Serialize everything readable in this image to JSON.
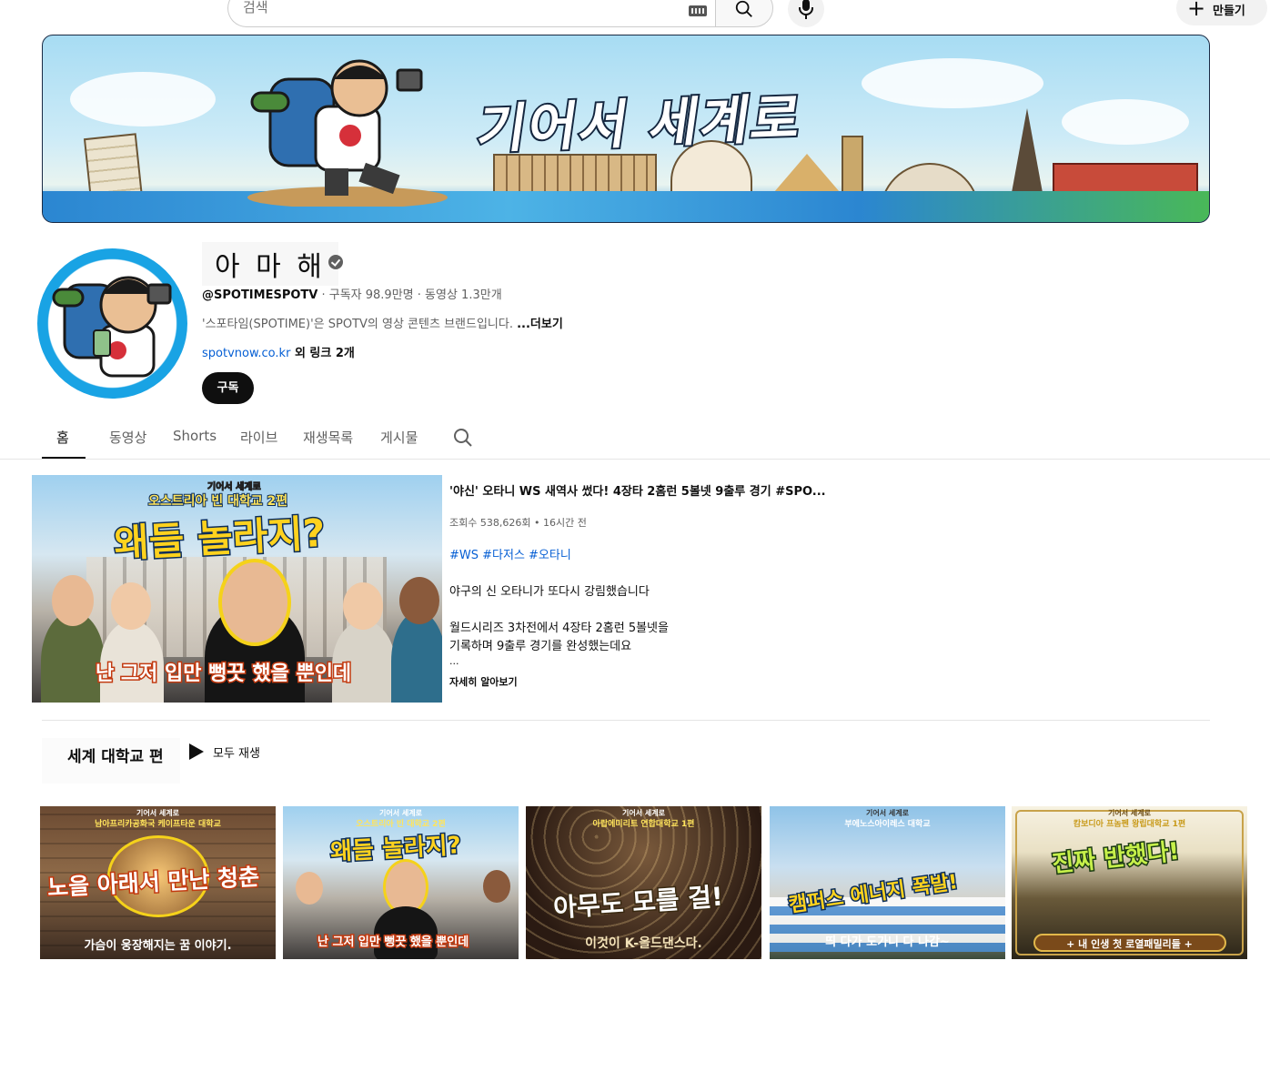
{
  "topbar": {
    "search_placeholder": "검색",
    "create_label": "만들기"
  },
  "banner": {
    "title": "기어서 세계로"
  },
  "channel": {
    "name": "아 마 해",
    "handle": "@SPOTIMESPOTV",
    "subscribers": "구독자 98.9만명",
    "videos": "동영상 1.3만개",
    "description": "'스포타임(SPOTIME)'은 SPOTV의 영상 콘텐츠 브랜드입니다.",
    "more": "...더보기",
    "link_url": "spotvnow.co.kr",
    "link_more": " 외 링크 2개",
    "subscribe_label": "구독"
  },
  "tabs": [
    {
      "label": "홈"
    },
    {
      "label": "동영상"
    },
    {
      "label": "Shorts"
    },
    {
      "label": "라이브"
    },
    {
      "label": "재생목록"
    },
    {
      "label": "게시물"
    }
  ],
  "featured": {
    "thumb_top": "기어서 세계로",
    "thumb_sub": "오스트리아 빈 대학교 2편",
    "thumb_main": "왜들 놀라지?",
    "thumb_bottom": "난 그저 입만 뻥끗 했을 뿐인데",
    "title": "'야신' 오타니 WS 새역사 썼다! 4장타 2홈런 5볼넷 9출루 경기 #SPO...",
    "views": "조회수 538,626회",
    "age": "16시간 전",
    "tags": "#WS #다저스 #오타니",
    "line1": "야구의 신 오타니가 또다시 강림했습니다",
    "line2": "월드시리즈 3차전에서 4장타 2홈런 5볼넷을",
    "line3": "기록하며 9출루 경기를 완성했는데요",
    "line4": "...",
    "more": "자세히 알아보기"
  },
  "shelf": {
    "title": "세계 대학교 편",
    "play_all": "모두 재생",
    "cards": [
      {
        "top": "기어서 세계로",
        "sub": "남아프리카공화국 케이프타운 대학교",
        "main": "노을 아래서 만난 청춘",
        "bottom": "가슴이 웅장해지는 꿈 이야기."
      },
      {
        "top": "기어서 세계로",
        "sub": "오스트리아 빈 대학교 2편",
        "main": "왜들 놀라지?",
        "bottom": "난 그저 입만 뻥끗 했을 뿐인데"
      },
      {
        "top": "기어서 세계로",
        "sub": "아랍에미리트 연합대학교 1편",
        "main": "아무도 모를 걸!",
        "bottom": "이것이 K-올드댄스다."
      },
      {
        "top": "기어서 세계로",
        "sub": "부에노스아이레스 대학교",
        "main": "캠퍼스 에너지 폭발!",
        "bottom": "띄 다가 도가니 다 나감~"
      },
      {
        "top": "기어서 세계로",
        "sub": "캄보디아 프놈펜 왕립대학교 1편",
        "main": "진짜 반했다!",
        "bottom": "+ 내 인생 첫 로열패밀리들 +"
      }
    ]
  },
  "colors": {
    "link": "#065fd4",
    "text_secondary": "#606060",
    "subscribe_bg": "#0f0f0f"
  }
}
